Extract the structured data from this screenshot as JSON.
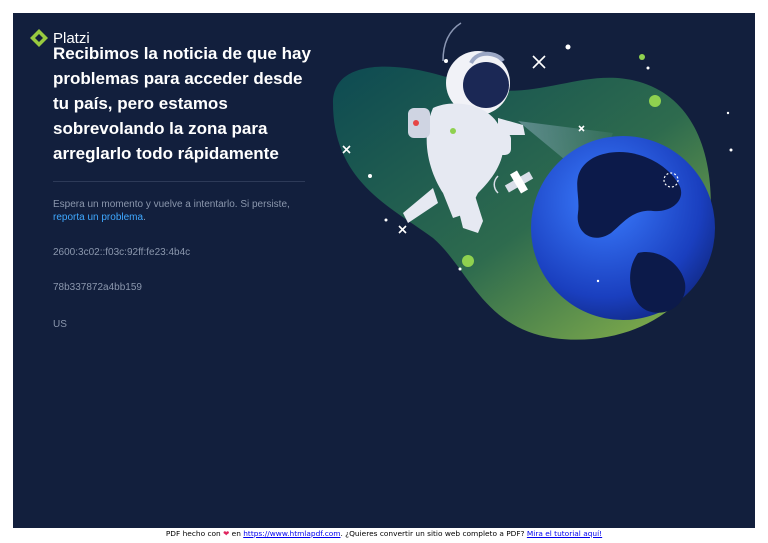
{
  "brand": {
    "name": "Platzi",
    "logo_color": "#98ca3f"
  },
  "headline": "Recibimos la noticia de que hay problemas para acceder desde tu país, pero estamos sobrevolando la zona para arreglarlo todo rápidamente",
  "message": {
    "text": "Espera un momento y vuelve a intentarlo. Si persiste, ",
    "link": "reporta un problema",
    "end": "."
  },
  "ip_address": "2600:3c02::f03c:92ff:fe23:4b4c",
  "ray_id": "78b337872a4bb159",
  "country": "US",
  "colors": {
    "background": "#121f3d",
    "accent_green": "#98ca3f",
    "link": "#3fa8ff"
  },
  "footer": {
    "prefix": "PDF hecho con",
    "heart": "❤",
    "middle": "en",
    "site_link": "https://www.htmlapdf.com",
    "question": ". ¿Quieres convertir un sitio web completo a PDF?",
    "tutorial_link": "Mira el tutorial aquí!"
  }
}
